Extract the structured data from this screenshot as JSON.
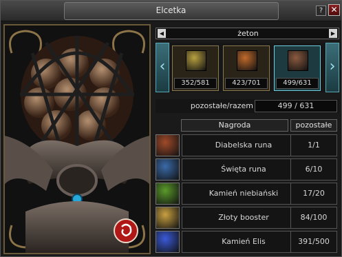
{
  "window": {
    "title": "Elcetka",
    "help_label": "?",
    "close_label": "✕"
  },
  "selector": {
    "label": "żeton",
    "left_arrow": "◀",
    "right_arrow": "▶"
  },
  "carousel": {
    "prev_label": "‹",
    "next_label": "›",
    "slots": [
      {
        "icon": "key-icon",
        "count": "352/581",
        "selected": false,
        "color": "#b8a040"
      },
      {
        "icon": "treasure-chest-icon",
        "count": "423/701",
        "selected": false,
        "color": "#c06a2a"
      },
      {
        "icon": "rune-icon",
        "count": "499/631",
        "selected": true,
        "color": "#8a5a40"
      }
    ]
  },
  "remaining": {
    "label": "pozostałe/razem",
    "value": "499 / 631"
  },
  "table": {
    "headers": {
      "reward": "Nagroda",
      "remaining": "pozostałe"
    },
    "rows": [
      {
        "icon": "rune-icon",
        "name": "Diabelska runa",
        "remaining": "1/1",
        "color": "#a04a2a"
      },
      {
        "icon": "rune-icon",
        "name": "Święta runa",
        "remaining": "6/10",
        "color": "#3a6aa8"
      },
      {
        "icon": "gem-stone-icon",
        "name": "Kamień niebiański",
        "remaining": "17/20",
        "color": "#5a9a2a"
      },
      {
        "icon": "booster-icon",
        "name": "Złoty booster",
        "remaining": "84/100",
        "color": "#c8a040"
      },
      {
        "icon": "crystal-icon",
        "name": "Kamień Elis",
        "remaining": "391/500",
        "color": "#3a5ad8"
      }
    ]
  }
}
